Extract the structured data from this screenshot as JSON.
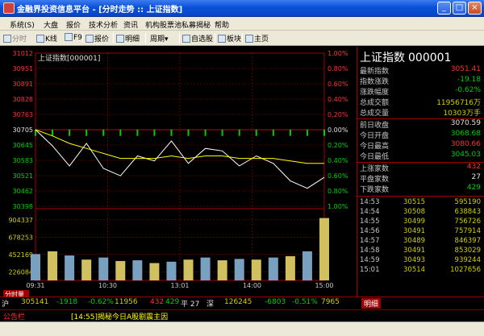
{
  "window": {
    "title": "金融界投资信息平台 - [分时走势 :: 上证指数]"
  },
  "menu": [
    "系统(S)",
    "大盘",
    "报价",
    "技术分析",
    "资讯",
    "机构股票池",
    "私募揭秘",
    "帮助"
  ],
  "toolbar": {
    "items": [
      "分时",
      "K线",
      "F9",
      "报价",
      "明细",
      "周期",
      "自选股",
      "板块",
      "主页"
    ]
  },
  "chart": {
    "label": "上证指数[000001]",
    "price_ticks": [
      "31012",
      "30951",
      "30891",
      "30828",
      "30763",
      "30705",
      "30645",
      "30583",
      "30521",
      "30462",
      "30398"
    ],
    "pct_ticks": [
      "1.00%",
      "0.80%",
      "0.60%",
      "0.40%",
      "0.20%",
      "0.00%",
      "0.20%",
      "0.40%",
      "0.60%",
      "0.80%",
      "1.00%"
    ],
    "vol_ticks": [
      "904337",
      "678253",
      "452169",
      "226084"
    ],
    "time_ticks": [
      "09:31",
      "10:30",
      "13:01",
      "14:00",
      "15:00"
    ],
    "vol_tab": "分时量"
  },
  "chart_data": {
    "type": "line",
    "x": [
      "09:31",
      "09:45",
      "10:00",
      "10:15",
      "10:30",
      "10:45",
      "11:00",
      "11:15",
      "11:30",
      "13:01",
      "13:15",
      "13:30",
      "13:45",
      "14:00",
      "14:15",
      "14:30",
      "14:45",
      "15:00"
    ],
    "series": [
      {
        "name": "上证指数",
        "values": [
          3070.5,
          3064,
          3056,
          3065,
          3055,
          3052,
          3060,
          3058,
          3066,
          3057,
          3063,
          3062,
          3056,
          3060,
          3057,
          3050,
          3047,
          3051.4
        ]
      },
      {
        "values": [
          3070.5,
          3068,
          3065,
          3063,
          3061,
          3059,
          3059,
          3059,
          3060,
          3059,
          3060,
          3060,
          3059,
          3059,
          3059,
          3058,
          3057,
          3057
        ]
      }
    ],
    "volume": [
      380000,
      420000,
      360000,
      300000,
      330000,
      280000,
      290000,
      250000,
      270000,
      300000,
      330000,
      290000,
      310000,
      300000,
      330000,
      350000,
      420000,
      900000
    ],
    "ylim": [
      3039.8,
      3101.2
    ],
    "ylabel": "",
    "xlabel": "",
    "grid": true
  },
  "quote": {
    "name": "上证指数",
    "code": "000001",
    "rows": [
      {
        "k": "最新指数",
        "v": "3051.41",
        "c": "red"
      },
      {
        "k": "指数涨跌",
        "v": "-19.18",
        "c": "grn"
      },
      {
        "k": "涨跌幅度",
        "v": "-0.62%",
        "c": "grn"
      },
      {
        "k": "总成交额",
        "v": "11956716万",
        "c": "yel"
      },
      {
        "k": "总成交量",
        "v": "10303万手",
        "c": "yel"
      },
      {
        "k": "前日收盘",
        "v": "3070.59",
        "c": "wht"
      },
      {
        "k": "今日开盘",
        "v": "3068.68",
        "c": "grn"
      },
      {
        "k": "今日最高",
        "v": "3080.66",
        "c": "red"
      },
      {
        "k": "今日最低",
        "v": "3045.03",
        "c": "grn"
      },
      {
        "k": "上涨家数",
        "v": "432",
        "c": "red"
      },
      {
        "k": "平盘家数",
        "v": "27",
        "c": "wht"
      },
      {
        "k": "下跌家数",
        "v": "429",
        "c": "grn"
      }
    ],
    "ticks": [
      {
        "t": "14:53",
        "p": "30515",
        "v": "595190"
      },
      {
        "t": "14:54",
        "p": "30508",
        "v": "638843"
      },
      {
        "t": "14:55",
        "p": "30499",
        "v": "756726"
      },
      {
        "t": "14:56",
        "p": "30491",
        "v": "757914"
      },
      {
        "t": "14:57",
        "p": "30489",
        "v": "846397"
      },
      {
        "t": "14:58",
        "p": "30491",
        "v": "853029"
      },
      {
        "t": "14:59",
        "p": "30493",
        "v": "939244"
      },
      {
        "t": "15:01",
        "p": "30514",
        "v": "1027656"
      }
    ]
  },
  "bottom": {
    "sh_label": "沪",
    "sh_idx": "305141",
    "sh_chg": "-1918",
    "sh_pct": "-0.62%",
    "sh_amt": "11956",
    "sh_up": "432",
    "sh_down": "429",
    "sh_flat": "平 27",
    "sz_label": "深",
    "sz_idx": "126245",
    "sz_chg": "-6803",
    "sz_pct": "-0.51%",
    "sz_amt": "7965",
    "btn_detail": "明细"
  },
  "ticker": {
    "label": "公告栏",
    "text": "[14:55]揭秘今日A股剧震主因"
  },
  "colors": {
    "up": "#ff3030",
    "down": "#00d000",
    "line": "#ffffff",
    "avg": "#ffff00",
    "axis": "#a00000"
  }
}
